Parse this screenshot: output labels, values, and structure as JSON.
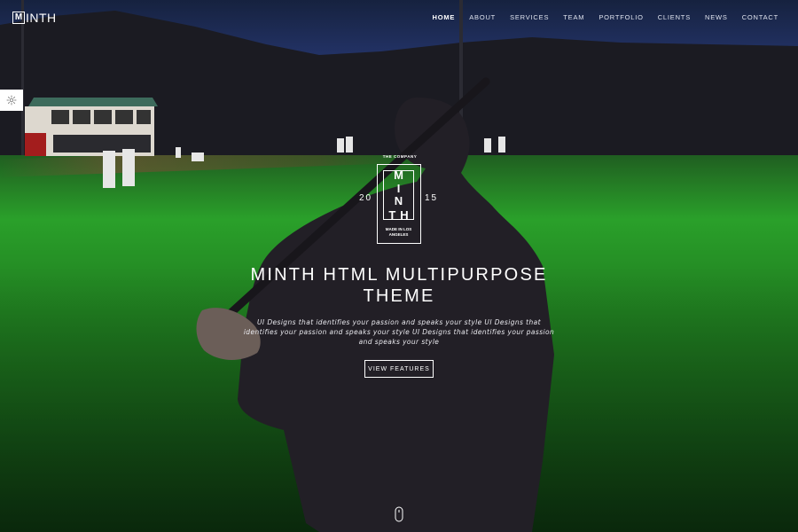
{
  "brand": {
    "logo_letter": "M",
    "logo_rest": "INTH"
  },
  "nav": {
    "items": [
      {
        "label": "HOME",
        "active": true
      },
      {
        "label": "ABOUT"
      },
      {
        "label": "SERVICES"
      },
      {
        "label": "TEAM"
      },
      {
        "label": "PORTFOLIO"
      },
      {
        "label": "CLIENTS"
      },
      {
        "label": "NEWS"
      },
      {
        "label": "CONTACT"
      }
    ]
  },
  "badge": {
    "top_text": "THE COMPANY",
    "line1": "M",
    "line2": "I N",
    "line3": "TH",
    "bottom_text": "MADE IN LOS ANGELES",
    "year_left": "20",
    "year_right": "15"
  },
  "hero": {
    "title_line1": "MINTH HTML MULTIPURPOSE",
    "title_line2": "THEME",
    "tagline": "UI Designs that identifies your passion and speaks your style UI Designs that identifies your passion and speaks your style UI Designs that identifies your passion and speaks your style",
    "cta_label": "VIEW FEATURES"
  },
  "icons": {
    "settings": "gear-icon",
    "scroll": "mouse-scroll-icon"
  },
  "colors": {
    "accent": "#ffffff",
    "field": "#2aa02a",
    "sky": "#24346a"
  }
}
